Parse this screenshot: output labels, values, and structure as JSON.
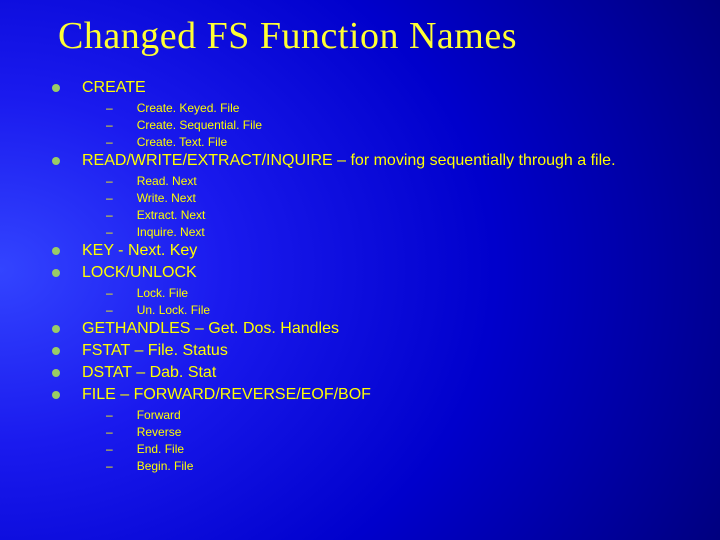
{
  "title": "Changed FS Function Names",
  "items": [
    {
      "level": 1,
      "text": "CREATE"
    },
    {
      "level": 2,
      "text": "Create. Keyed. File"
    },
    {
      "level": 2,
      "text": "Create. Sequential. File"
    },
    {
      "level": 2,
      "text": "Create. Text. File"
    },
    {
      "level": 1,
      "text": "READ/WRITE/EXTRACT/INQUIRE – for moving sequentially through a file."
    },
    {
      "level": 2,
      "text": "Read. Next"
    },
    {
      "level": 2,
      "text": "Write. Next"
    },
    {
      "level": 2,
      "text": "Extract. Next"
    },
    {
      "level": 2,
      "text": "Inquire. Next"
    },
    {
      "level": 1,
      "text": "KEY - Next. Key"
    },
    {
      "level": 1,
      "text": "LOCK/UNLOCK"
    },
    {
      "level": 2,
      "text": "Lock. File"
    },
    {
      "level": 2,
      "text": "Un. Lock. File"
    },
    {
      "level": 1,
      "text": "GETHANDLES – Get. Dos. Handles"
    },
    {
      "level": 1,
      "text": "FSTAT – File. Status"
    },
    {
      "level": 1,
      "text": "DSTAT – Dab. Stat"
    },
    {
      "level": 1,
      "text": "FILE – FORWARD/REVERSE/EOF/BOF"
    },
    {
      "level": 2,
      "text": "Forward"
    },
    {
      "level": 2,
      "text": "Reverse"
    },
    {
      "level": 2,
      "text": "End. File"
    },
    {
      "level": 2,
      "text": "Begin. File"
    }
  ]
}
